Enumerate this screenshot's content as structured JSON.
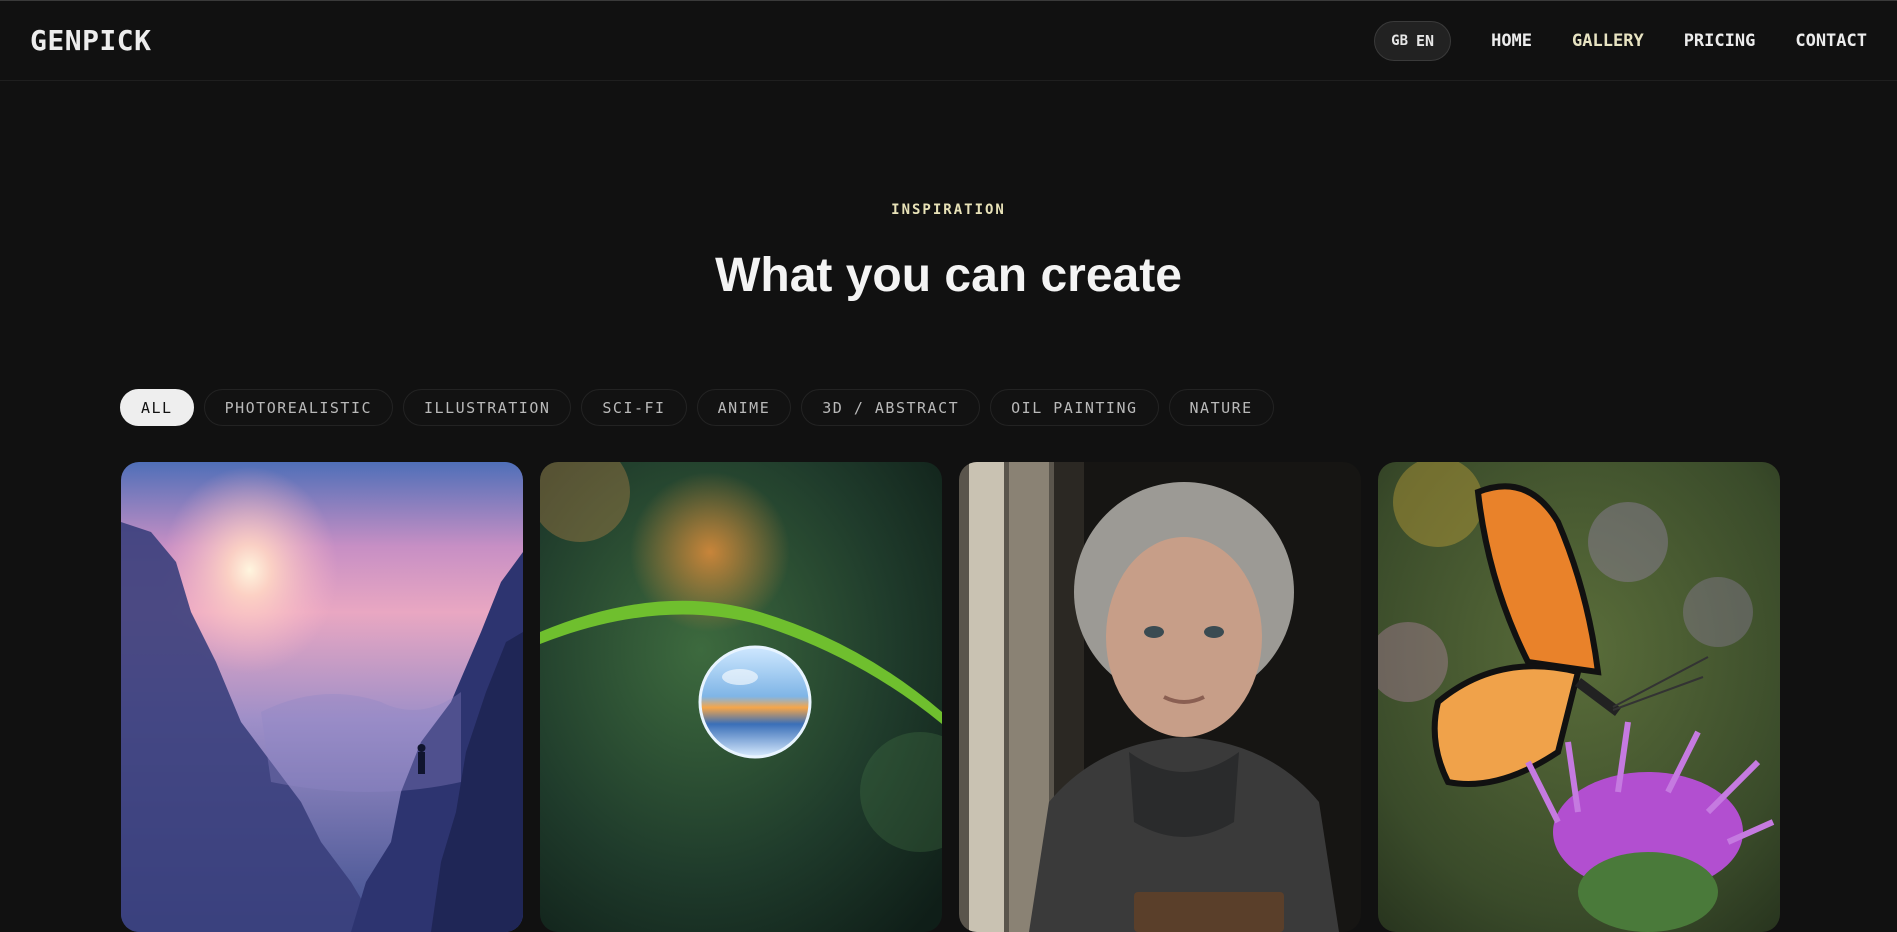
{
  "header": {
    "logo": "GENPICK",
    "language": {
      "flag": "GB",
      "code": "EN"
    },
    "nav": [
      {
        "label": "HOME"
      },
      {
        "label": "GALLERY",
        "active": true
      },
      {
        "label": "PRICING"
      },
      {
        "label": "CONTACT"
      }
    ]
  },
  "section": {
    "eyebrow": "INSPIRATION",
    "title": "What you can create"
  },
  "filters": [
    {
      "label": "ALL",
      "active": true
    },
    {
      "label": "PHOTOREALISTIC"
    },
    {
      "label": "ILLUSTRATION"
    },
    {
      "label": "SCI-FI"
    },
    {
      "label": "ANIME"
    },
    {
      "label": "3D / ABSTRACT"
    },
    {
      "label": "OIL PAINTING"
    },
    {
      "label": "NATURE"
    }
  ],
  "gallery": [
    {
      "subject": "misty canyon sunset with hiker"
    },
    {
      "subject": "water droplet on grass blade"
    },
    {
      "subject": "elderly woman portrait by window"
    },
    {
      "subject": "monarch butterfly on thistle"
    }
  ],
  "colors": {
    "background": "#111111",
    "accent": "#e8e2b8",
    "chip_active_bg": "#eeeeee"
  }
}
